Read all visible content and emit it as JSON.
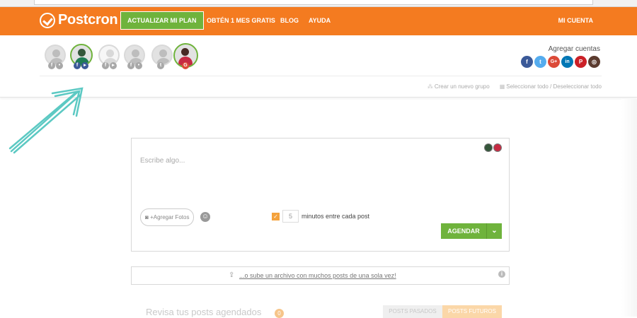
{
  "header": {
    "logo_text": "Postcron",
    "plan_button": "ACTUALIZAR MI PLAN",
    "nav": [
      "OBTÉN 1 MES GRATIS",
      "BLOG",
      "AYUDA"
    ],
    "account": "MI CUENTA",
    "accent": "#f47b20"
  },
  "accounts": {
    "add_label": "Agregar cuentas",
    "networks": [
      {
        "icon": "facebook-icon",
        "glyph": "f",
        "color": "#3b5998"
      },
      {
        "icon": "twitter-icon",
        "glyph": "t",
        "color": "#55acee"
      },
      {
        "icon": "google-plus-icon",
        "glyph": "G+",
        "color": "#dc4a38"
      },
      {
        "icon": "linkedin-icon",
        "glyph": "in",
        "color": "#0077b5"
      },
      {
        "icon": "pinterest-icon",
        "glyph": "P",
        "color": "#cb2027"
      },
      {
        "icon": "instagram-icon",
        "glyph": "◎",
        "color": "#5b3b2f"
      }
    ],
    "create_group": "Crear un nuevo grupo",
    "select_all": "Seleccionar todo / Deseleccionar todo"
  },
  "composer": {
    "placeholder": "Escribe algo...",
    "photo_button": "+Agregar Fotos",
    "minutes_value": "5",
    "minutes_label": "minutos entre cada post",
    "schedule_button": "AGENDAR"
  },
  "upload": {
    "link_text": "...o sube un archivo con muchos posts de una sola vez!"
  },
  "review": {
    "title": "Revisa tus posts agendados",
    "count": "0",
    "tab_past": "POSTS PASADOS",
    "tab_future": "POSTS FUTUROS"
  }
}
